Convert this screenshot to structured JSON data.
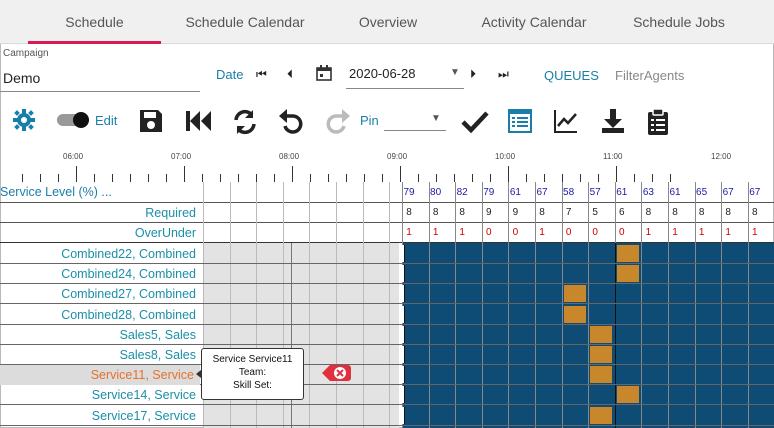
{
  "tabs": [
    "Schedule",
    "Schedule Calendar",
    "Overview",
    "Activity Calendar",
    "Schedule Jobs"
  ],
  "campaign": {
    "label": "Campaign",
    "value": "Demo"
  },
  "date": {
    "label": "Date",
    "value": "2020-06-28"
  },
  "links": {
    "queues": "QUEUES",
    "filter": "FilterAgents"
  },
  "toolbar": {
    "edit_label": "Edit",
    "pin_label": "Pin"
  },
  "timeline": {
    "labels": [
      "06:00",
      "07:00",
      "08:00",
      "09:00",
      "10:00",
      "11:00",
      "12:00"
    ]
  },
  "metrics": {
    "service_level_label": "Service Level (%) ...",
    "required_label": "Required",
    "overunder_label": "OverUnder",
    "service_level": [
      "79",
      "80",
      "82",
      "79",
      "61",
      "67",
      "58",
      "57",
      "61",
      "63",
      "61",
      "65",
      "67",
      "67"
    ],
    "required": [
      "8",
      "8",
      "8",
      "9",
      "9",
      "8",
      "7",
      "5",
      "6",
      "8",
      "8",
      "8",
      "8",
      "8"
    ],
    "overunder": [
      "1",
      "1",
      "1",
      "0",
      "0",
      "1",
      "0",
      "0",
      "0",
      "1",
      "1",
      "1",
      "1",
      "1"
    ]
  },
  "agents": [
    "Combined22, Combined",
    "Combined24, Combined",
    "Combined27, Combined",
    "Combined28, Combined",
    "Sales5, Sales",
    "Sales8, Sales",
    "Service11, Service",
    "Service14, Service",
    "Service17, Service"
  ],
  "tooltip": {
    "line1": "Service Service11",
    "line2": "Team:",
    "line3": "Skill Set:"
  },
  "colors": {
    "accent": "#1a7fa8",
    "tab_active": "#d81b55",
    "shift_blue": "#0f4c75",
    "break_orange": "#c8872a",
    "under": "#cc0000",
    "level": "#1a1aa8"
  }
}
